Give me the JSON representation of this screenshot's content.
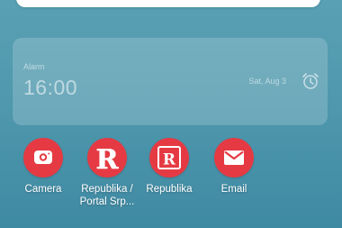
{
  "alarm": {
    "label": "Alarm",
    "time": "16:00",
    "date": "Sat, Aug 3",
    "icon": "alarm-clock-icon"
  },
  "apps": [
    {
      "label": "Camera",
      "icon": "camera-icon"
    },
    {
      "label": "Republika / Portal Srp...",
      "icon": "republika-portal-logo-icon"
    },
    {
      "label": "Republika",
      "icon": "republika-logo-icon"
    },
    {
      "label": "Email",
      "icon": "email-icon"
    }
  ],
  "colors": {
    "app_icon_red": "#e53a43",
    "wallpaper": "#4f98ad"
  }
}
